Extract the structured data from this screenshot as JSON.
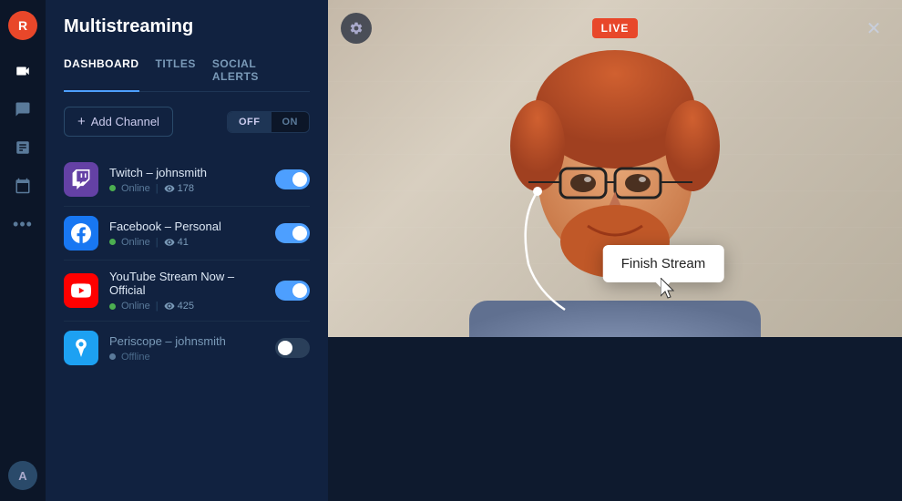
{
  "app": {
    "logo": "R",
    "title": "Multistreaming"
  },
  "nav": {
    "items": [
      {
        "id": "video",
        "icon": "🎬",
        "active": false
      },
      {
        "id": "chat",
        "icon": "💬",
        "active": false
      },
      {
        "id": "analytics",
        "icon": "📊",
        "active": false
      },
      {
        "id": "calendar",
        "icon": "📅",
        "active": false
      },
      {
        "id": "more",
        "icon": "···",
        "active": false
      }
    ],
    "avatar_label": "A"
  },
  "panel": {
    "title": "Multistreaming",
    "tabs": [
      {
        "id": "dashboard",
        "label": "DASHBOARD",
        "active": true
      },
      {
        "id": "titles",
        "label": "TITLES",
        "active": false
      },
      {
        "id": "social_alerts",
        "label": "SOCIAL ALERTS",
        "active": false
      }
    ],
    "add_channel_label": "+ Add Channel",
    "toggle_off": "OFF",
    "toggle_on": "ON",
    "channels": [
      {
        "id": "twitch",
        "name": "Twitch – johnsmith",
        "platform": "Twitch",
        "status": "Online",
        "viewers": 178,
        "enabled": true
      },
      {
        "id": "facebook",
        "name": "Facebook – Personal",
        "platform": "Facebook",
        "status": "Online",
        "viewers": 41,
        "enabled": true
      },
      {
        "id": "youtube",
        "name": "YouTube Stream Now – Official",
        "platform": "YouTube",
        "status": "Online",
        "viewers": 425,
        "enabled": true
      },
      {
        "id": "periscope",
        "name": "Periscope – johnsmith",
        "platform": "Periscope",
        "status": "Offline",
        "viewers": null,
        "enabled": false
      }
    ]
  },
  "video": {
    "live_badge": "LIVE",
    "finish_stream_label": "Finish Stream"
  }
}
